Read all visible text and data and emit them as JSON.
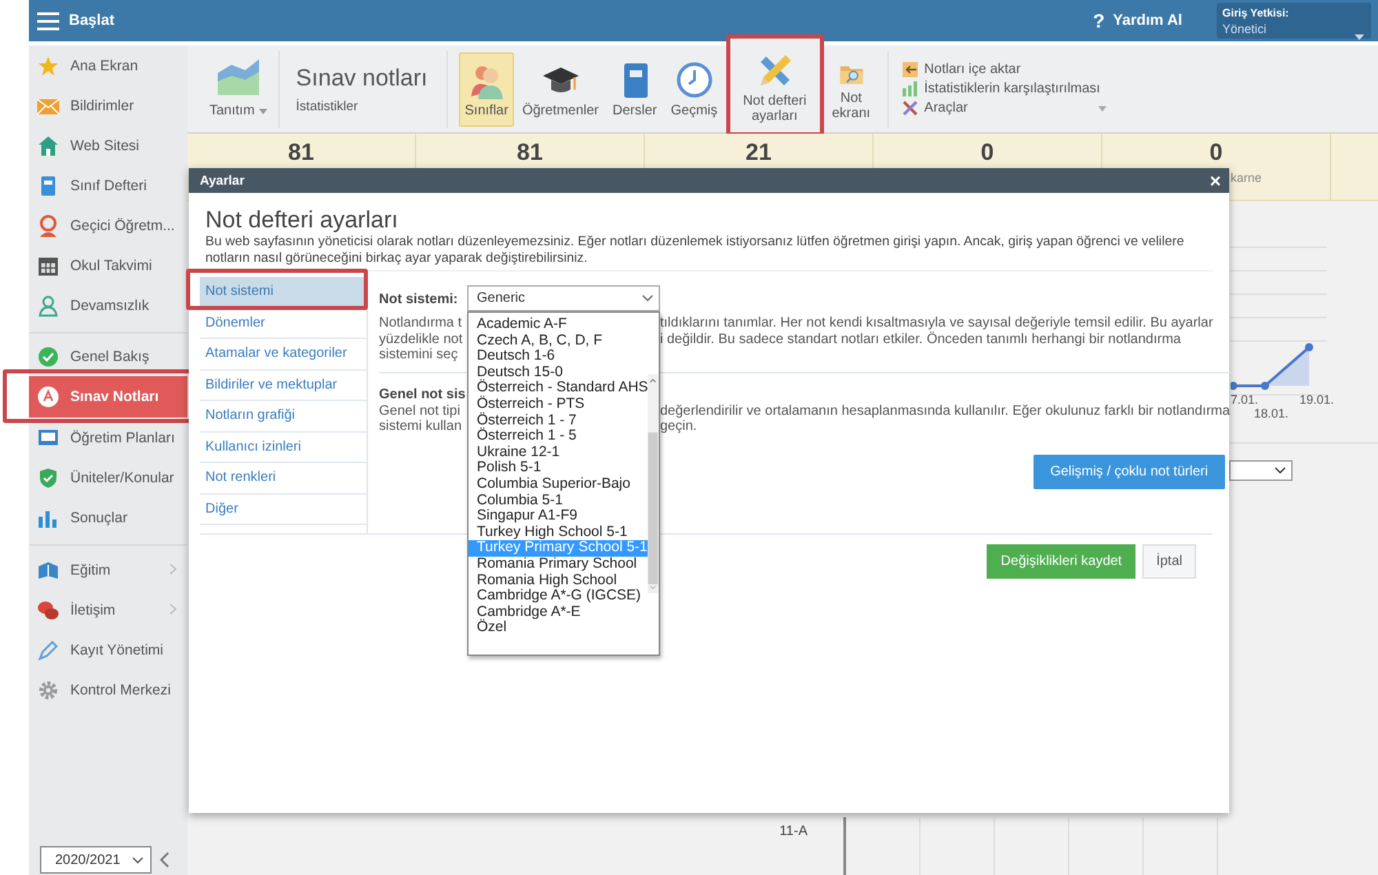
{
  "top_bar": {
    "title": "Başlat",
    "help_icon": "?",
    "help": "Yardım Al",
    "role_label": "Giriş Yetkisi:",
    "role_value": "Yönetici"
  },
  "sidebar": {
    "groups": [
      {
        "items": [
          {
            "label": "Ana Ekran",
            "selected": false,
            "highlighted": false,
            "submenu": false
          },
          {
            "label": "Bildirimler",
            "selected": false,
            "highlighted": false,
            "submenu": false
          },
          {
            "label": "Web Sitesi",
            "selected": false,
            "highlighted": false,
            "submenu": false
          },
          {
            "label": "Sınıf Defteri",
            "selected": false,
            "highlighted": false,
            "submenu": false
          },
          {
            "label": "Geçici Öğretm...",
            "selected": false,
            "highlighted": false,
            "submenu": false
          },
          {
            "label": "Okul Takvimi",
            "selected": false,
            "highlighted": false,
            "submenu": false
          },
          {
            "label": "Devamsızlık",
            "selected": false,
            "highlighted": false,
            "submenu": false
          }
        ]
      },
      {
        "items": [
          {
            "label": "Genel Bakış",
            "selected": false,
            "highlighted": false,
            "submenu": false
          },
          {
            "label": "Sınav Notları",
            "selected": true,
            "highlighted": true,
            "submenu": false
          },
          {
            "label": "Öğretim Planları",
            "selected": false,
            "highlighted": false,
            "submenu": false
          },
          {
            "label": "Üniteler/Konular",
            "selected": false,
            "highlighted": false,
            "submenu": false
          },
          {
            "label": "Sonuçlar",
            "selected": false,
            "highlighted": false,
            "submenu": false
          }
        ]
      },
      {
        "items": [
          {
            "label": "Eğitim",
            "selected": false,
            "highlighted": false,
            "submenu": true
          },
          {
            "label": "İletişim",
            "selected": false,
            "highlighted": false,
            "submenu": true
          },
          {
            "label": "Kayıt Yönetimi",
            "selected": false,
            "highlighted": false,
            "submenu": false
          },
          {
            "label": "Kontrol Merkezi",
            "selected": false,
            "highlighted": false,
            "submenu": false
          }
        ]
      }
    ],
    "year": "2020/2021"
  },
  "ribbon": {
    "menu": "Tanıtım",
    "title": "Sınav notları",
    "subtitle": "İstatistikler",
    "buttons": [
      {
        "label": "Sınıflar",
        "selected": true,
        "highlighted": false
      },
      {
        "label": "Öğretmenler",
        "selected": false,
        "highlighted": false
      },
      {
        "label": "Dersler",
        "selected": false,
        "highlighted": false
      },
      {
        "label": "Geçmiş",
        "selected": false,
        "highlighted": false
      },
      {
        "label": "Not defteri ayarları",
        "selected": false,
        "highlighted": true
      },
      {
        "label": "Not ekranı",
        "selected": false,
        "highlighted": false
      }
    ],
    "links": [
      {
        "label": "Notları içe aktar",
        "dropdown": false
      },
      {
        "label": "İstatistiklerin karşılaştırılması",
        "dropdown": false
      },
      {
        "label": "Araçlar",
        "dropdown": true
      }
    ]
  },
  "stats": [
    {
      "value": "81"
    },
    {
      "value": "81"
    },
    {
      "value": "21"
    },
    {
      "value": "0"
    },
    {
      "value": "0",
      "caption": "karne"
    }
  ],
  "background": {
    "chart_dates": [
      "7.01.",
      "18.01.",
      "19.01."
    ],
    "class_label": "11-A"
  },
  "dialog": {
    "title": "Ayarlar",
    "close_icon": "×",
    "heading": "Not defteri ayarları",
    "intro": "Bu web sayfasının yöneticisi olarak notları düzenleyemezsiniz. Eğer notları düzenlemek istiyorsanız lütfen öğretmen girişi yapın. Ancak, giriş yapan öğrenci ve velilere notların nasıl görüneceğini birkaç ayar yaparak değiştirebilirsiniz.",
    "nav": [
      {
        "label": "Not sistemi",
        "selected": true,
        "highlighted": true
      },
      {
        "label": "Dönemler",
        "selected": false,
        "highlighted": false
      },
      {
        "label": "Atamalar ve kategoriler",
        "selected": false,
        "highlighted": false
      },
      {
        "label": "Bildiriler ve mektuplar",
        "selected": false,
        "highlighted": false
      },
      {
        "label": "Notların grafiği",
        "selected": false,
        "highlighted": false
      },
      {
        "label": "Kullanıcı izinleri",
        "selected": false,
        "highlighted": false
      },
      {
        "label": "Not renkleri",
        "selected": false,
        "highlighted": false
      },
      {
        "label": "Diğer",
        "selected": false,
        "highlighted": false
      }
    ],
    "field_label": "Not sistemi:",
    "select_value": "Generic",
    "description": [
      {
        "left": "Notlandırma t",
        "right": "tıldıklarını tanımlar. Her not kendi kısaltmasıyla ve sayısal değeriyle temsil edilir. Bu ayarlar"
      },
      {
        "left": "yüzdelikle not",
        "right": "i değildir. Bu sadece standart notları etkiler. Önceden tanımlı herhangi bir notlandırma"
      },
      {
        "left": "sistemini seç"
      }
    ],
    "section_title": "Genel not sis",
    "section_text": [
      {
        "left": "Genel not tipi",
        "right": "değerlendirilir ve ortalamanın hesaplanmasında kullanılır. Eğer okulunuz farklı bir notlandırma"
      },
      {
        "left": "sistemi kullan",
        "right": "geçin."
      }
    ],
    "advanced_button": "Gelişmiş / çoklu not türleri",
    "save_button": "Değişiklikleri kaydet",
    "cancel_button": "İptal",
    "options": [
      {
        "label": "Academic A-F",
        "selected": false
      },
      {
        "label": "Czech A, B, C, D, F",
        "selected": false
      },
      {
        "label": "Deutsch 1-6",
        "selected": false
      },
      {
        "label": "Deutsch 15-0",
        "selected": false
      },
      {
        "label": "Österreich - Standard AHS",
        "selected": false
      },
      {
        "label": "Österreich - PTS",
        "selected": false
      },
      {
        "label": "Österreich 1 - 7",
        "selected": false
      },
      {
        "label": "Österreich 1 - 5",
        "selected": false
      },
      {
        "label": "Ukraine 12-1",
        "selected": false
      },
      {
        "label": "Polish 5-1",
        "selected": false
      },
      {
        "label": "Columbia Superior-Bajo",
        "selected": false
      },
      {
        "label": "Columbia 5-1",
        "selected": false
      },
      {
        "label": "Singapur A1-F9",
        "selected": false
      },
      {
        "label": "Turkey High School 5-1",
        "selected": false
      },
      {
        "label": "Turkey Primary School 5-1",
        "selected": true
      },
      {
        "label": "Romania Primary School",
        "selected": false
      },
      {
        "label": "Romania High School",
        "selected": false
      },
      {
        "label": "Cambridge A*-G (IGCSE)",
        "selected": false
      },
      {
        "label": "Cambridge A*-E",
        "selected": false
      },
      {
        "label": "Özel",
        "selected": false
      }
    ]
  }
}
